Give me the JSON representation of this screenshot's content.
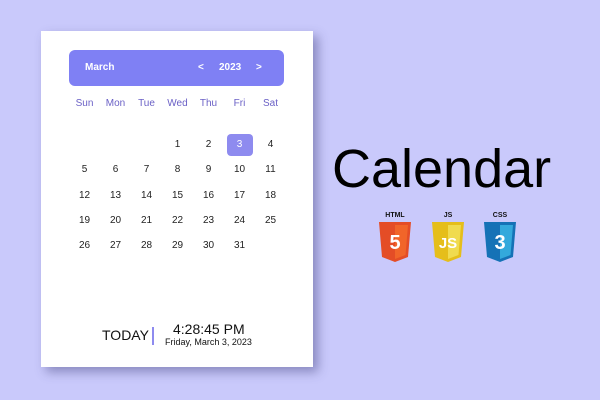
{
  "header": {
    "month": "March",
    "year": "2023",
    "prev_label": "<",
    "next_label": ">"
  },
  "weekdays": [
    "Sun",
    "Mon",
    "Tue",
    "Wed",
    "Thu",
    "Fri",
    "Sat"
  ],
  "days": [
    [
      "",
      "",
      "",
      "1",
      "2",
      "3",
      "4"
    ],
    [
      "5",
      "6",
      "7",
      "8",
      "9",
      "10",
      "11"
    ],
    [
      "12",
      "13",
      "14",
      "15",
      "16",
      "17",
      "18"
    ],
    [
      "19",
      "20",
      "21",
      "22",
      "23",
      "24",
      "25"
    ],
    [
      "26",
      "27",
      "28",
      "29",
      "30",
      "31",
      ""
    ]
  ],
  "selected_day": "3",
  "footer": {
    "today_label": "TODAY",
    "time": "4:28:45 PM",
    "date": "Friday, March 3, 2023"
  },
  "title": "Calendar",
  "tech_badges": [
    {
      "label": "HTML",
      "glyph": "5",
      "color": "#e44d26"
    },
    {
      "label": "JS",
      "glyph": "JS",
      "color": "#f0db4f"
    },
    {
      "label": "CSS",
      "glyph": "3",
      "color": "#1572b6"
    }
  ],
  "colors": {
    "background": "#c9c9fb",
    "accent": "#7f80f4",
    "weekday_text": "#6b61c6"
  }
}
